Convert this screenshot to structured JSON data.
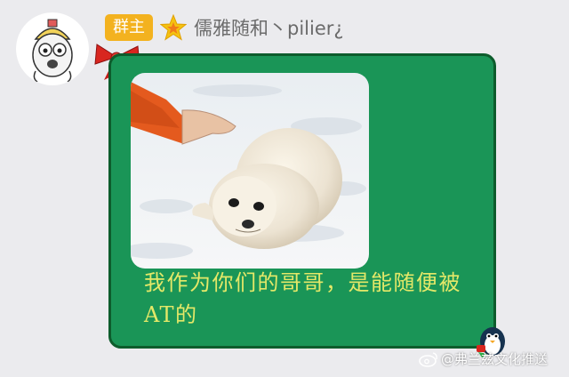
{
  "message": {
    "sender": {
      "role_badge": "群主",
      "nickname": "儒雅随和丶pilier¿",
      "avatar_icon": "cartoon-seal-avatar-icon",
      "title_icon": "star-icon"
    },
    "bubble_color": "#1a9557",
    "bubble_border_color": "#0d5c2c",
    "caption_color": "#e4e868",
    "caption": "我作为你们的哥哥，是能随便被AT的",
    "image_icon": "baby-seal-photo"
  },
  "watermark": {
    "text": "@弗兰兹文化推送",
    "icon": "weibo-icon"
  }
}
